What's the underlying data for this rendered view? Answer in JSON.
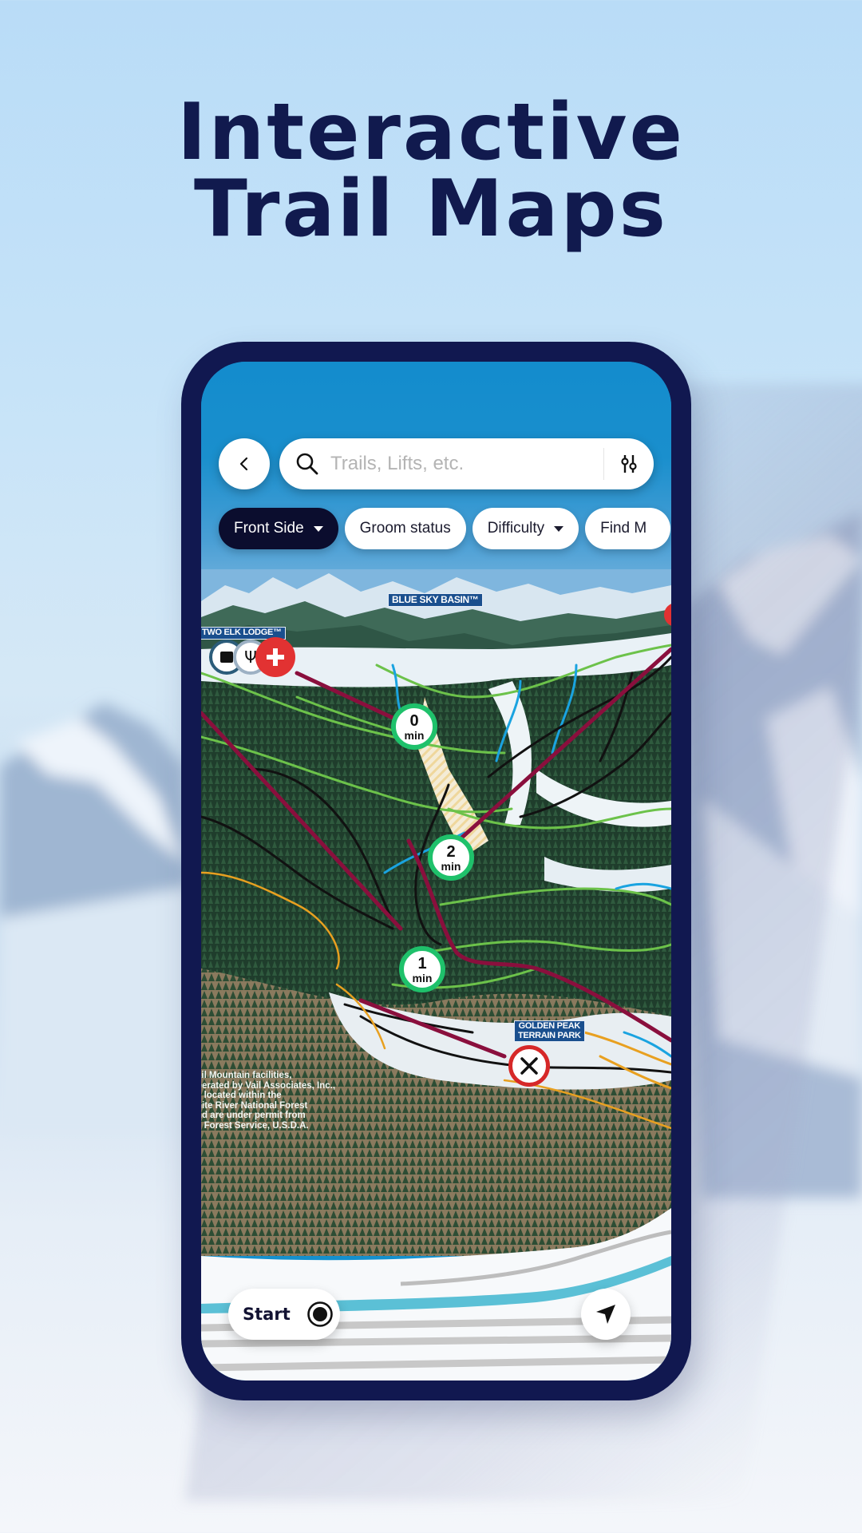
{
  "headline": {
    "line1": "Interactive",
    "line2": "Trail Maps"
  },
  "app": {
    "back_icon": "chevron-left-icon",
    "search": {
      "placeholder": "Trails, Lifts, etc.",
      "value": "",
      "icon": "search-icon",
      "filter_icon": "sliders-icon"
    },
    "chips": [
      {
        "label": "Front Side",
        "active": true,
        "dropdown": true
      },
      {
        "label": "Groom status",
        "active": false,
        "dropdown": false
      },
      {
        "label": "Difficulty",
        "active": false,
        "dropdown": true
      },
      {
        "label": "Find M",
        "active": false,
        "dropdown": false
      }
    ],
    "map": {
      "labels": {
        "blue_sky_basin": "BLUE SKY BASIN™",
        "two_elk_lodge": "TWO ELK LODGE™",
        "golden_peak_line1": "GOLDEN PEAK",
        "golden_peak_line2": "TERRAIN PARK"
      },
      "disclaimer": "ail Mountain facilities,\nperated by Vail Associates, Inc.,\ne located within the\nhite River National Forest\nnd are under permit from\ne Forest Service, U.S.D.A.",
      "lift_timers": [
        {
          "value": "0",
          "unit": "min"
        },
        {
          "value": "2",
          "unit": "min"
        },
        {
          "value": "1",
          "unit": "min"
        }
      ],
      "poi_icons": [
        "info-board-icon",
        "restaurant-icon",
        "first-aid-icon",
        "closed-x-icon"
      ],
      "colors": {
        "timer_ring": "#1fc16b",
        "lift_line": "#8a0f3d",
        "green_trail": "#6cc24a",
        "blue_trail": "#1aa3e0",
        "black_trail": "#111111",
        "orange_trail": "#e8a020",
        "first_aid": "#e23232",
        "closed_ring": "#d62828"
      }
    },
    "bottom": {
      "start_label": "Start",
      "start_icon": "radio-target-icon",
      "locate_icon": "navigation-arrow-icon"
    }
  },
  "colors": {
    "headline": "#111a4e",
    "phone_frame": "#111850",
    "active_chip": "#0b0d2e"
  }
}
